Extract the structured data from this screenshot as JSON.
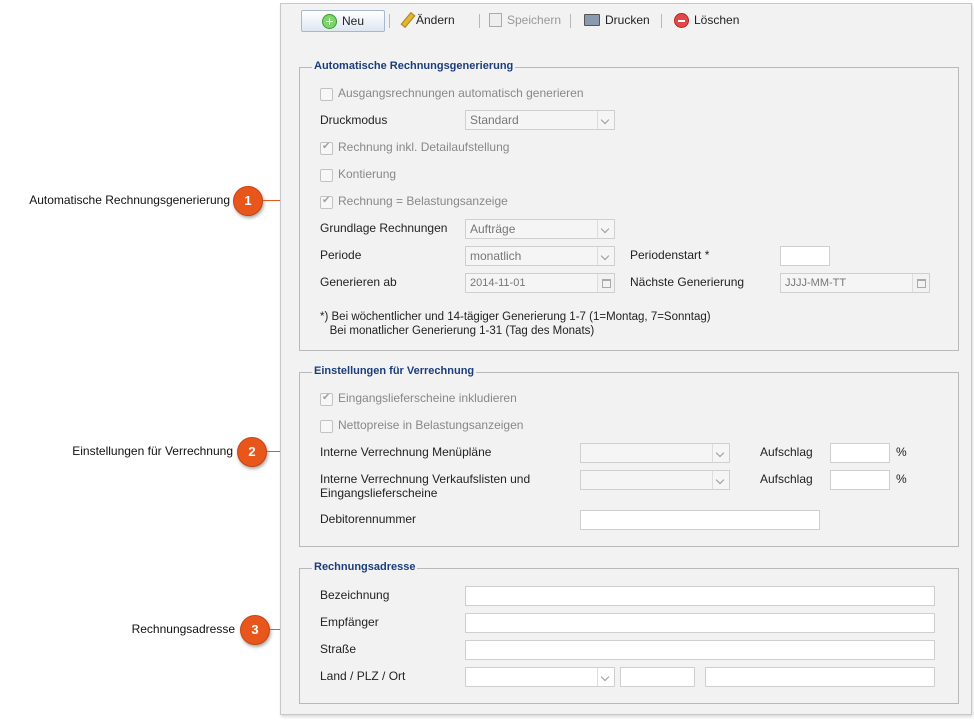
{
  "annotations": [
    {
      "label": "Automatische Rechnungsgenerierung",
      "number": "1"
    },
    {
      "label": "Einstellungen für Verrechnung",
      "number": "2"
    },
    {
      "label": "Rechnungsadresse",
      "number": "3"
    }
  ],
  "toolbar": {
    "new_label": "Neu",
    "edit_label": "Ändern",
    "save_label": "Speichern",
    "print_label": "Drucken",
    "delete_label": "Löschen"
  },
  "auto_invoice": {
    "title": "Automatische Rechnungsgenerierung",
    "auto_generate_label": "Ausgangsrechnungen automatisch generieren",
    "print_mode_label": "Druckmodus",
    "print_mode_value": "Standard",
    "detail_label": "Rechnung inkl. Detailaufstellung",
    "account_label": "Kontierung",
    "invoice_equals_label": "Rechnung = Belastungsanzeige",
    "basis_label": "Grundlage Rechnungen",
    "basis_value": "Aufträge",
    "period_label": "Periode",
    "period_value": "monatlich",
    "period_start_label": "Periodenstart *",
    "generate_from_label": "Generieren ab",
    "generate_from_value": "2014-11-01",
    "next_generation_label": "Nächste Generierung",
    "next_generation_placeholder": "JJJJ-MM-TT",
    "note": "*) Bei wöchentlicher und 14-tägiger Generierung 1-7 (1=Montag, 7=Sonntag)\n   Bei monatlicher Generierung 1-31 (Tag des Monats)"
  },
  "settlement": {
    "title": "Einstellungen für Verrechnung",
    "include_delivery_label": "Eingangslieferscheine inkludieren",
    "net_prices_label": "Nettopreise in Belastungsanzeigen",
    "menu_plans_label": "Interne Verrechnung Menüpläne",
    "surcharge_label": "Aufschlag",
    "percent": "%",
    "sales_lists_label": "Interne Verrechnung Verkaufslisten und\nEingangslieferscheine",
    "debtor_label": "Debitorennummer"
  },
  "address": {
    "title": "Rechnungsadresse",
    "designation_label": "Bezeichnung",
    "recipient_label": "Empfänger",
    "street_label": "Straße",
    "country_label": "Land / PLZ / Ort"
  },
  "colors": {
    "accent": "#e8561c",
    "section_title": "#1c3d7a",
    "panel_bg": "#f2f2f2"
  }
}
